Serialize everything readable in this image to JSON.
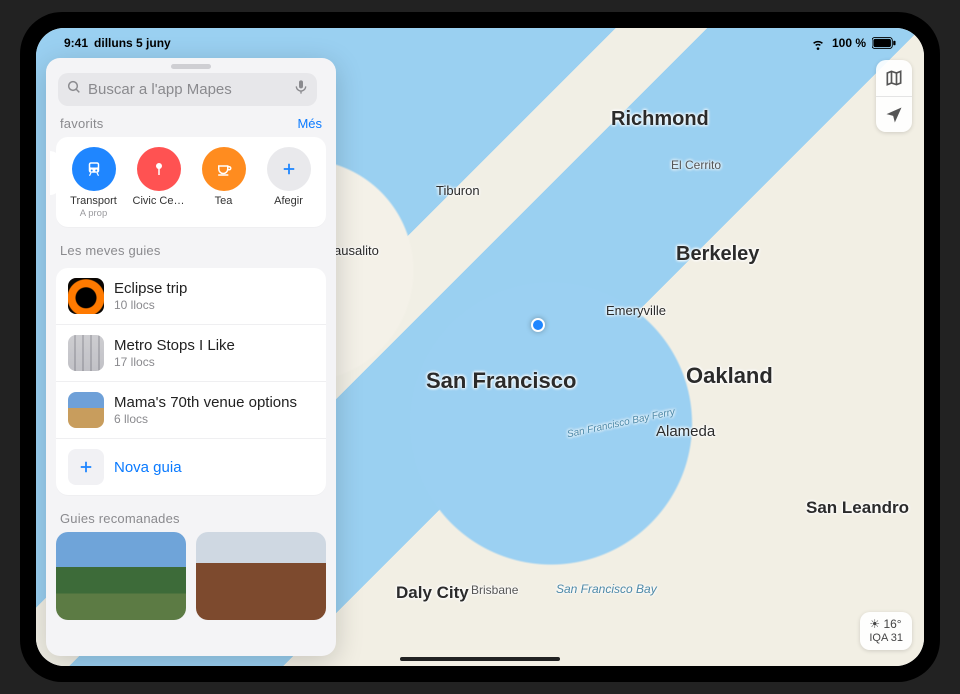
{
  "status": {
    "time": "9:41",
    "date": "dilluns 5 juny",
    "battery": "100 %"
  },
  "search": {
    "placeholder": "Buscar a l'app Mapes"
  },
  "sections": {
    "favorites_title": "favorits",
    "favorites_more": "Més",
    "guides_title": "Les meves guies",
    "recommended_title": "Guies recomanades"
  },
  "favorites": [
    {
      "label": "Transport",
      "sub": "A prop",
      "color": "c-blue",
      "icon": "transit"
    },
    {
      "label": "Civic Ce…",
      "sub": "",
      "color": "c-red",
      "icon": "pin"
    },
    {
      "label": "Tea",
      "sub": "",
      "color": "c-orange",
      "icon": "cup"
    },
    {
      "label": "Afegir",
      "sub": "",
      "color": "c-add",
      "icon": "plus"
    }
  ],
  "guides": [
    {
      "title": "Eclipse trip",
      "sub": "10 llocs",
      "thumb": "t-eclipse"
    },
    {
      "title": "Metro Stops I Like",
      "sub": "17 llocs",
      "thumb": "t-metro"
    },
    {
      "title": "Mama's 70th venue options",
      "sub": "6 llocs",
      "thumb": "t-venue"
    }
  ],
  "new_guide_label": "Nova guia",
  "weather": {
    "temp": "16°",
    "aqi": "IQA 31"
  },
  "map_labels": {
    "sf": "San Francisco",
    "oak": "Oakland",
    "rich": "Richmond",
    "berk": "Berkeley",
    "ala": "Alameda",
    "emv": "Emeryville",
    "daly": "Daly City",
    "sanl": "San Leandro",
    "tib": "Tiburon",
    "sau": "ausalito",
    "bris": "Brisbane",
    "elc": "El Cerrito",
    "sfwater": "San Francisco Bay",
    "ferry": "San Francisco Bay Ferry"
  }
}
